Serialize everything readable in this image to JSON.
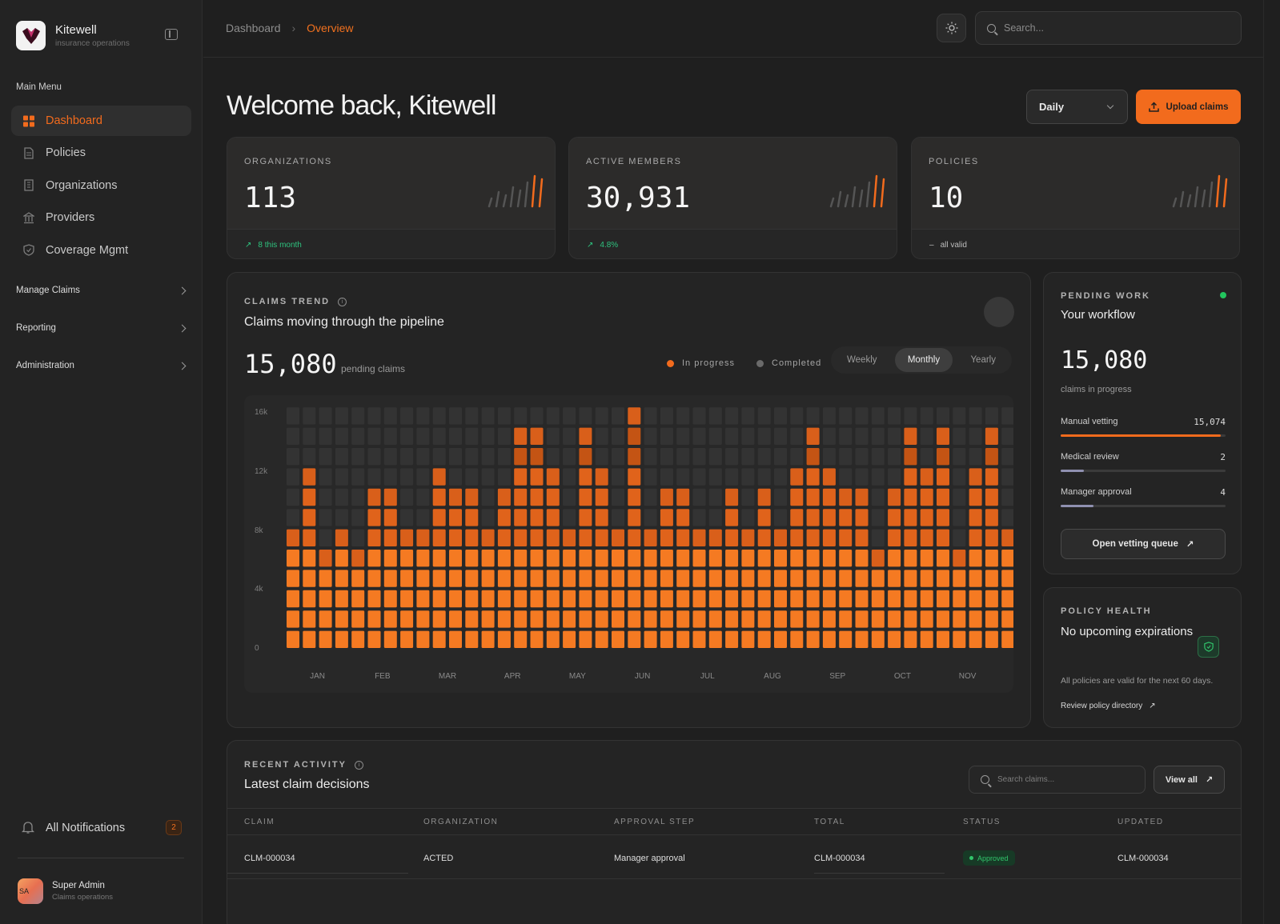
{
  "brand": {
    "name": "Kitewell",
    "subtitle": "insurance operations"
  },
  "sidebar": {
    "menu_label": "Main Menu",
    "items": [
      {
        "label": "Dashboard",
        "icon": "grid-icon",
        "active": true
      },
      {
        "label": "Policies",
        "icon": "file-icon",
        "active": false
      },
      {
        "label": "Organizations",
        "icon": "building-icon",
        "active": false
      },
      {
        "label": "Providers",
        "icon": "bank-icon",
        "active": false
      },
      {
        "label": "Coverage Mgmt",
        "icon": "shield-icon",
        "active": false
      }
    ],
    "groups": [
      {
        "label": "Manage Claims"
      },
      {
        "label": "Reporting"
      },
      {
        "label": "Administration"
      }
    ],
    "notifications": {
      "label": "All Notifications",
      "count": "2"
    },
    "user": {
      "initials": "SA",
      "name": "Super Admin",
      "role": "Claims operations"
    }
  },
  "topbar": {
    "breadcrumb": {
      "root": "Dashboard",
      "current": "Overview"
    },
    "search_placeholder": "Search..."
  },
  "header": {
    "welcome": "Welcome back, Kitewell",
    "period": "Daily",
    "upload_label": "Upload claims"
  },
  "kpis": [
    {
      "label": "ORGANIZATIONS",
      "value": "113",
      "sub": "8 this month",
      "sub_icon": "arrow-up-right-icon",
      "sub_color": "#2ec27e"
    },
    {
      "label": "ACTIVE MEMBERS",
      "value": "30,931",
      "sub": "4.8%",
      "sub_icon": "arrow-up-right-icon",
      "sub_color": "#2ec27e"
    },
    {
      "label": "POLICIES",
      "value": "10",
      "sub": "all valid",
      "sub_icon": "dash-icon",
      "sub_color": "#bdbdbd"
    }
  ],
  "trend": {
    "label": "CLAIMS TREND",
    "title": "Claims moving through the pipeline",
    "value": "15,080",
    "value_sub": "pending claims",
    "legend": [
      {
        "label": "In progress",
        "color": "#f26b1d"
      },
      {
        "label": "Completed",
        "color": "#6a6a6a"
      }
    ],
    "tabs": [
      {
        "label": "Weekly"
      },
      {
        "label": "Monthly",
        "active": true
      },
      {
        "label": "Yearly"
      }
    ]
  },
  "chart_data": {
    "type": "bar",
    "categories": [
      "JAN",
      "FEB",
      "MAR",
      "APR",
      "MAY",
      "JUN",
      "JUL",
      "AUG",
      "SEP",
      "OCT",
      "NOV",
      "DEC"
    ],
    "values": [
      [
        8,
        6,
        8,
        10,
        12,
        10,
        10,
        10,
        14,
        12,
        14,
        16
      ],
      [
        8,
        6,
        6,
        8,
        8,
        8,
        6,
        8,
        6,
        6,
        10,
        8
      ],
      [
        12,
        14,
        12,
        10,
        8,
        10,
        8,
        6,
        12,
        10,
        6,
        10
      ],
      [
        12,
        10,
        8,
        10,
        10,
        16,
        10,
        10,
        14,
        10,
        10,
        12
      ],
      [
        6,
        8,
        10,
        12,
        14,
        16,
        8,
        6,
        10,
        10,
        12,
        14
      ],
      [
        8,
        10,
        12,
        14,
        14,
        8,
        6,
        8,
        12,
        14,
        16,
        12
      ],
      [
        8,
        10,
        10,
        12,
        12,
        10,
        10,
        8,
        10,
        12,
        14,
        16
      ],
      [
        10,
        8,
        10,
        14,
        14,
        10,
        8,
        12,
        14,
        12,
        12,
        16
      ]
    ],
    "ylim": [
      0,
      16
    ],
    "yticks": [
      "16k",
      "12k",
      "8k",
      "4k",
      "0"
    ],
    "color_active": "#f26b1d",
    "color_empty": "#333333"
  },
  "pending": {
    "label": "PENDING WORK",
    "title": "Your workflow",
    "value": "15,080",
    "value_sub": "claims in progress",
    "stages": [
      {
        "label": "Manual vetting",
        "count": "15,074",
        "fill": 0.97,
        "color": "#f26b1d"
      },
      {
        "label": "Medical review",
        "count": "2",
        "fill": 0.14,
        "color": "#8f90b0"
      },
      {
        "label": "Manager approval",
        "count": "4",
        "fill": 0.2,
        "color": "#8f90b0"
      }
    ],
    "button": "Open vetting queue"
  },
  "health": {
    "label": "POLICY HEALTH",
    "title": "No upcoming expirations",
    "desc": "All policies are valid for the next 60 days.",
    "link": "Review policy directory"
  },
  "recent": {
    "label": "RECENT ACTIVITY",
    "title": "Latest claim decisions",
    "search_placeholder": "Search claims...",
    "view_all": "View all",
    "columns": [
      "CLAIM",
      "ORGANIZATION",
      "APPROVAL STEP",
      "TOTAL",
      "STATUS",
      "UPDATED"
    ],
    "rows": [
      {
        "claim": "CLM-000034",
        "org": "ACTED",
        "step": "Manager approval",
        "total": "CLM-000034",
        "status": "Approved",
        "updated": "CLM-000034"
      }
    ]
  }
}
